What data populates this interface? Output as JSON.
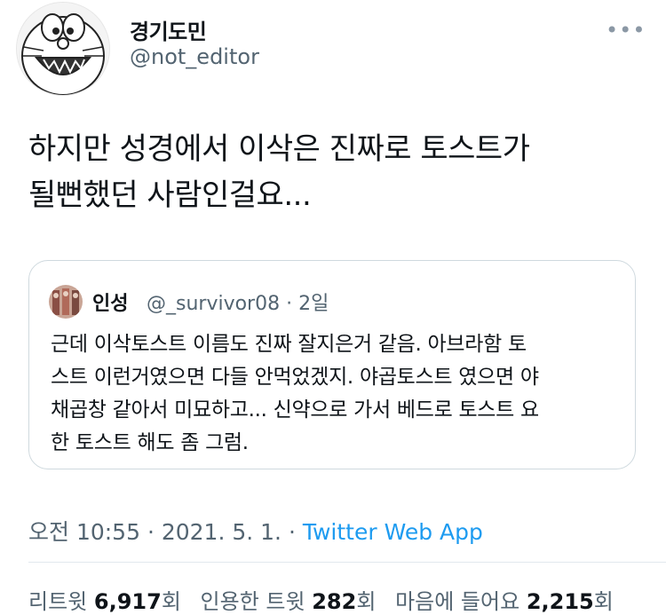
{
  "author": {
    "name": "경기도민",
    "handle": "@not_editor"
  },
  "more_icon": "•••",
  "tweet": {
    "text_line1": "하지만 성경에서 이삭은 진짜로 토스트가",
    "text_line2": "될뻔했던 사람인걸요..."
  },
  "quote": {
    "name": "인성",
    "handle": "@_survivor08 · 2일",
    "line1": "근데 이삭토스트 이름도 진짜 잘지은거 같음. 아브라함 토",
    "line2": "스트 이런거였으면 다들 안먹었겠지. 야곱토스트 였으면 야",
    "line3": "채곱창 같아서 미묘하고... 신약으로 가서 베드로 토스트 요",
    "line4": "한 토스트 해도 좀 그럼."
  },
  "meta": {
    "time": "오전 10:55 · 2021. 5. 1. · ",
    "source": "Twitter Web App"
  },
  "stats": {
    "retweets_label": "리트윗",
    "retweets_count": "6,917",
    "retweets_unit": "회",
    "quotes_label": "인용한 트윗",
    "quotes_count": "282",
    "quotes_unit": "회",
    "likes_label": "마음에 들어요",
    "likes_count": "2,215",
    "likes_unit": "회"
  }
}
